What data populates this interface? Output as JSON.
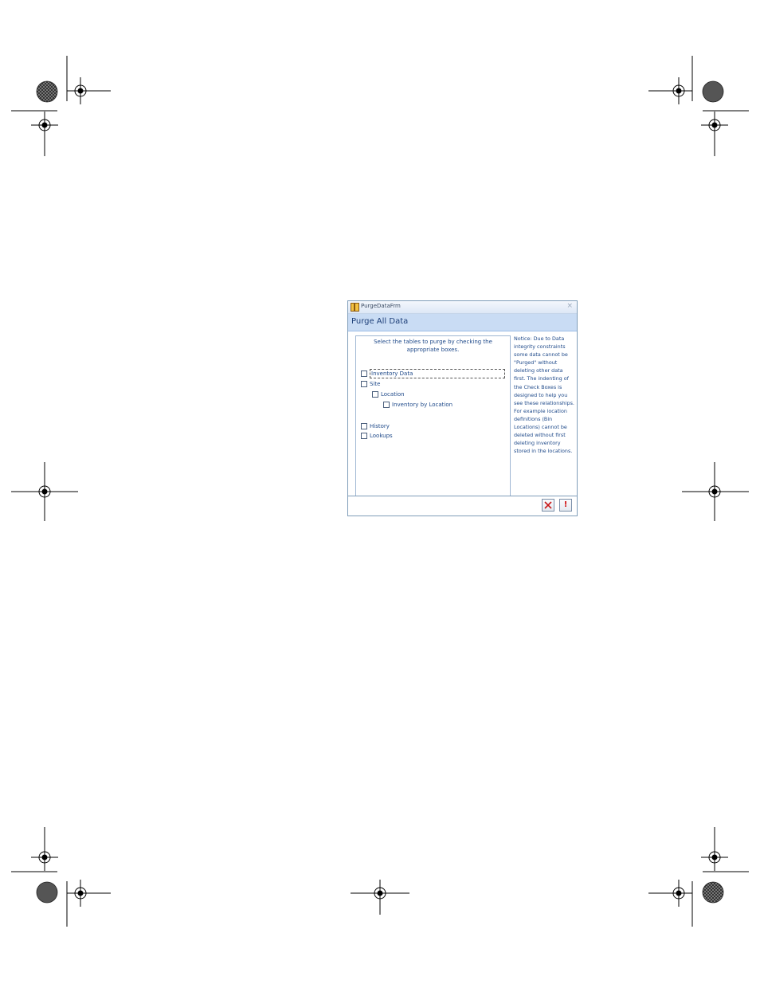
{
  "window": {
    "title": "PurgeDataFrm",
    "close_glyph": "×"
  },
  "form": {
    "heading": "Purge All Data",
    "instruction": "Select the tables to purge by checking the appropriate boxes.",
    "checkboxes": [
      {
        "label": "Inventory Data",
        "checked": false,
        "focused": true
      },
      {
        "label": "Site",
        "checked": false
      },
      {
        "label": "Location",
        "checked": false
      },
      {
        "label": "Inventory by Location",
        "checked": false
      },
      {
        "label": "History",
        "checked": false
      },
      {
        "label": "Lookups",
        "checked": false
      }
    ],
    "notice": "Notice: Due to Data integrity constraints some data cannot be \"Purged\" without deleting other data first. The indenting of the Check Boxes is designed to help you see these relationships. For example location definitions (Bin Locations) cannot be deleted without first deleting inventory stored in the  locations."
  },
  "footer": {
    "cancel_icon": "red-x-icon",
    "run_icon": "exclamation-icon",
    "run_glyph": "!"
  },
  "colors": {
    "text_blue": "#1f4a8a",
    "header_band": "#c9dcf4",
    "border": "#7f9db9",
    "danger_red": "#d01010"
  }
}
